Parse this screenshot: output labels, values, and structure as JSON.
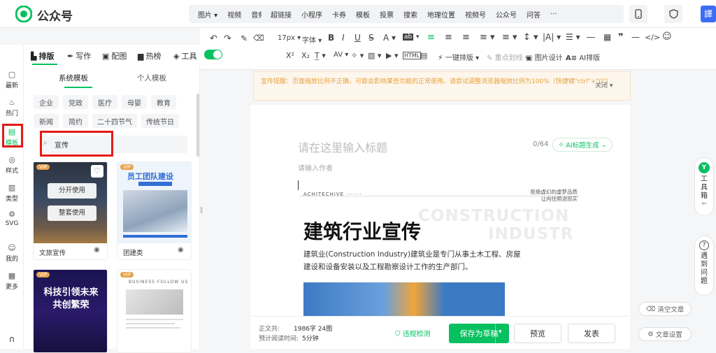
{
  "app": {
    "name": "公众号"
  },
  "top_toolbar": {
    "group1": [
      "图片 ▾",
      "视频",
      "音频 ▾"
    ],
    "group2": [
      "超链接",
      "小程序",
      "卡券",
      "模板",
      "投票",
      "搜索",
      "地理位置",
      "视频号",
      "公众号",
      "问答",
      "···"
    ]
  },
  "format_toolbar": {
    "row1": {
      "font_size": "17px ▾",
      "font": "字体 ▾"
    },
    "row2": {
      "one_click": "一键排版 ▾",
      "highlight": "重点划线 ▾",
      "image_design": "图片设计",
      "ai_layout": "AI排版"
    }
  },
  "left_nav": [
    {
      "label": "最新",
      "icon": "chat-icon"
    },
    {
      "label": "热门",
      "icon": "flame-icon"
    },
    {
      "label": "模板",
      "icon": "template-icon"
    },
    {
      "label": "样式",
      "icon": "style-icon"
    },
    {
      "label": "类型",
      "icon": "grid-icon"
    },
    {
      "label": "SVG",
      "icon": "svg-icon"
    },
    {
      "label": "我的",
      "icon": "user-icon"
    },
    {
      "label": "更多",
      "icon": "more-icon"
    }
  ],
  "editor_tabs": [
    {
      "label": "排版",
      "active": true
    },
    {
      "label": "写作",
      "active": false
    },
    {
      "label": "配图",
      "active": false
    },
    {
      "label": "热榜",
      "active": false
    },
    {
      "label": "工具",
      "active": false
    }
  ],
  "panel": {
    "tabs": [
      "系统模板",
      "个人模板"
    ],
    "chips_row1": [
      "企业",
      "党政",
      "医疗",
      "母婴",
      "教育"
    ],
    "chips_row2": [
      "新闻",
      "简约",
      "二十四节气",
      "传统节日"
    ],
    "search_value": "宣传",
    "cards": [
      {
        "caption": "文旅宣传",
        "btn1": "分开使用",
        "btn2": "整套使用",
        "badge": "VIP"
      },
      {
        "caption": "团建类",
        "banner": "员工团队建设",
        "badge": "VIP"
      },
      {
        "title": "科技引领未来 共创繁荣",
        "badge": "VIP"
      },
      {
        "title": "BUSINESS FOLLOW US",
        "badge": "VIP"
      }
    ]
  },
  "notice": {
    "text": "宣传提醒：页面缩放比例不正确，可能会影响某些功能的正常使用。请尝试调整浏览器缩放比例为100%（快捷键\"ctrl\"+\"0\"）",
    "close_label": "关闭"
  },
  "editor": {
    "title_placeholder": "请在这里输入标题",
    "title_count": "0/64",
    "ai_title_button": "AI标题生成",
    "author_placeholder": "请输入作者",
    "archive_label": "ACHITECHIVE ·······",
    "quote_line1": "拒绝虚幻的虚梦品质",
    "quote_line2": "让向往照进现实",
    "bg_word1": "CONSTRUCTION",
    "bg_word2": "INDUSTR",
    "headline": "建筑行业宣传",
    "body_line1": "建筑业(Construction Industry)建筑业是专门从事土木工程、房屋",
    "body_line2": "建设和设备安装以及工程勘察设计工作的生产部门。"
  },
  "footer": {
    "stats_label1": "正文共:",
    "stats_value1": "1986字 24图",
    "stats_label2": "预计阅读时间:",
    "stats_value2": "5分钟",
    "check_label": "违规检测",
    "save_label": "保存为草稿",
    "preview_label": "预览",
    "publish_label": "发表"
  },
  "right_side": {
    "toolbox": "工具箱",
    "help": "遇到问题",
    "clear": "清空文章",
    "settings": "文章设置"
  },
  "colors": {
    "accent": "#07c160",
    "red": "#e21b1b",
    "notice": "#e6a23c"
  }
}
